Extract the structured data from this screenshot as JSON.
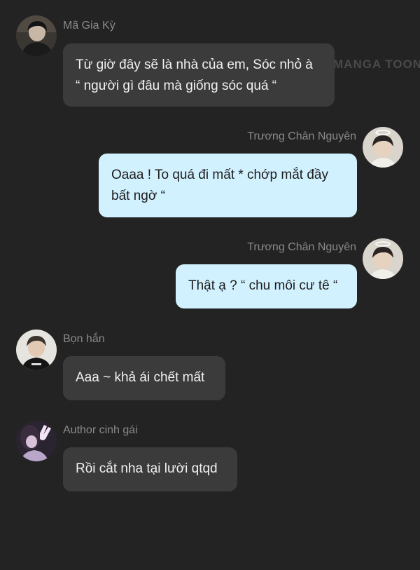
{
  "watermark": "MANGA TOON",
  "messages": [
    {
      "sender": "Mã Gia Kỳ",
      "side": "left",
      "avatar": "avatar-dark-hair-boy",
      "lines": [
        "Từ giờ đây sẽ là nhà của em, Sóc nhỏ à",
        "“ người gì đâu mà giống sóc quá “"
      ]
    },
    {
      "sender": "Trương Chân Nguyên",
      "side": "right",
      "avatar": "avatar-boy-with-halo",
      "lines": [
        "Oaaa ! To quá đi mất * chớp mắt đầy",
        "bất ngờ “"
      ]
    },
    {
      "sender": "Trương Chân Nguyên",
      "side": "right",
      "avatar": "avatar-boy-with-halo",
      "lines": [
        "Thật ạ ? “ chu môi cư tê “"
      ]
    },
    {
      "sender": "Bọn hắn",
      "side": "left",
      "avatar": "avatar-boy-black-shirt",
      "lines": [
        "Aaa ~ khả ái chết mất"
      ]
    },
    {
      "sender": "Author cinh gái",
      "side": "left",
      "avatar": "avatar-girl-peace-sign",
      "lines": [
        "Rồi cắt nha tại lười qtqd"
      ]
    }
  ],
  "colors": {
    "background": "#232323",
    "incoming_bubble": "#3b3b3b",
    "outgoing_bubble": "#d2f1ff",
    "name_text": "#8a8a8a"
  }
}
